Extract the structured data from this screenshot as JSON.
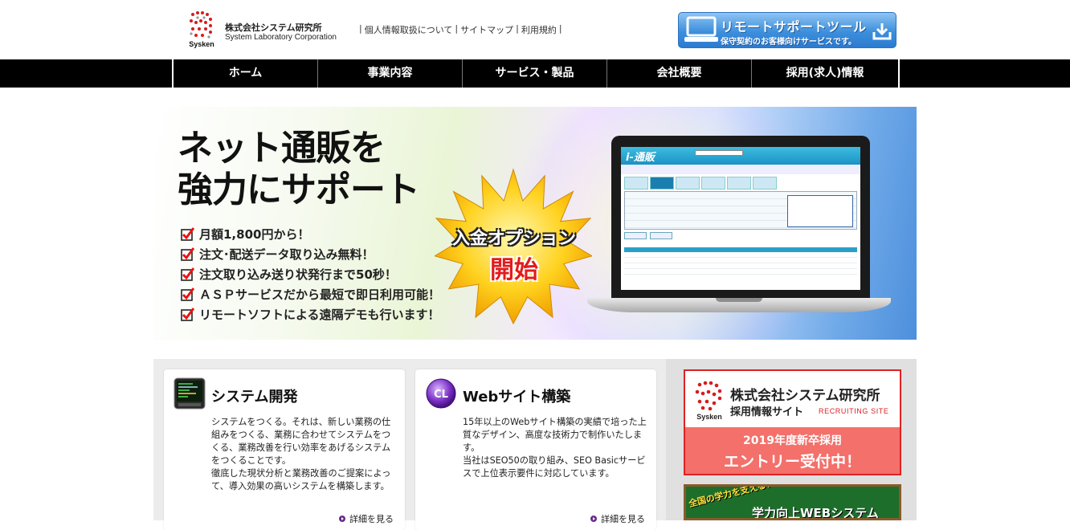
{
  "header": {
    "company_ja": "株式会社システム研究所",
    "company_en": "System Laboratory Corporation",
    "logo_word": "Sysken",
    "links": [
      "個人情報取扱について",
      "サイトマップ",
      "利用規約"
    ],
    "remote": {
      "title": "リモートサポートツール",
      "subtitle": "保守契約のお客様向けサービスです。",
      "icon": "download-icon"
    }
  },
  "nav": [
    "ホーム",
    "事業内容",
    "サービス・製品",
    "会社概要",
    "採用(求人)情報"
  ],
  "hero": {
    "headline_1": "ネット通販を",
    "headline_2": "強力にサポート",
    "points": [
      "月額1,800円から！",
      "注文･配送データ取り込み無料！",
      "注文取り込み送り状発行まで50秒！",
      "ＡＳＰサービスだから最短で即日利用可能！",
      "リモートソフトによる遠隔デモも行います！"
    ],
    "badge_1": "入金オプション",
    "badge_2": "開始",
    "screen_logo": "i-通販"
  },
  "cards": [
    {
      "title": "システム開発",
      "body": "システムをつくる。それは、新しい業務の仕組みをつくる、業務に合わせてシステムをつくる、業務改善を行い効率をあげるシステムをつくることです。\n徹底した現状分析と業務改善のご提案によって、導入効果の高いシステムを構築します。",
      "more": "詳細を見る"
    },
    {
      "title": "Webサイト構築",
      "body": "15年以上のWebサイト構築の実績で培った上質なデザイン、高度な技術力で制作いたします。\n当社はSEO50の取り組み、SEO Basicサービスで上位表示要件に対応しています。",
      "more": "詳細を見る"
    }
  ],
  "recruit": {
    "name": "株式会社システム研究所",
    "sub": "採用情報サイト",
    "en": "RECRUITING SITE",
    "year": "2019年度新卒採用",
    "entry": "エントリー受付中！",
    "logo_word": "Sysken"
  },
  "study": {
    "left": "全国の学力を支える！",
    "main": "学力向上WEBシステム"
  },
  "colors": {
    "nav_bg": "#000000",
    "accent_red": "#dd2222",
    "recruit_pink": "#f3706b",
    "remote_blue": "#3d8fdc"
  }
}
